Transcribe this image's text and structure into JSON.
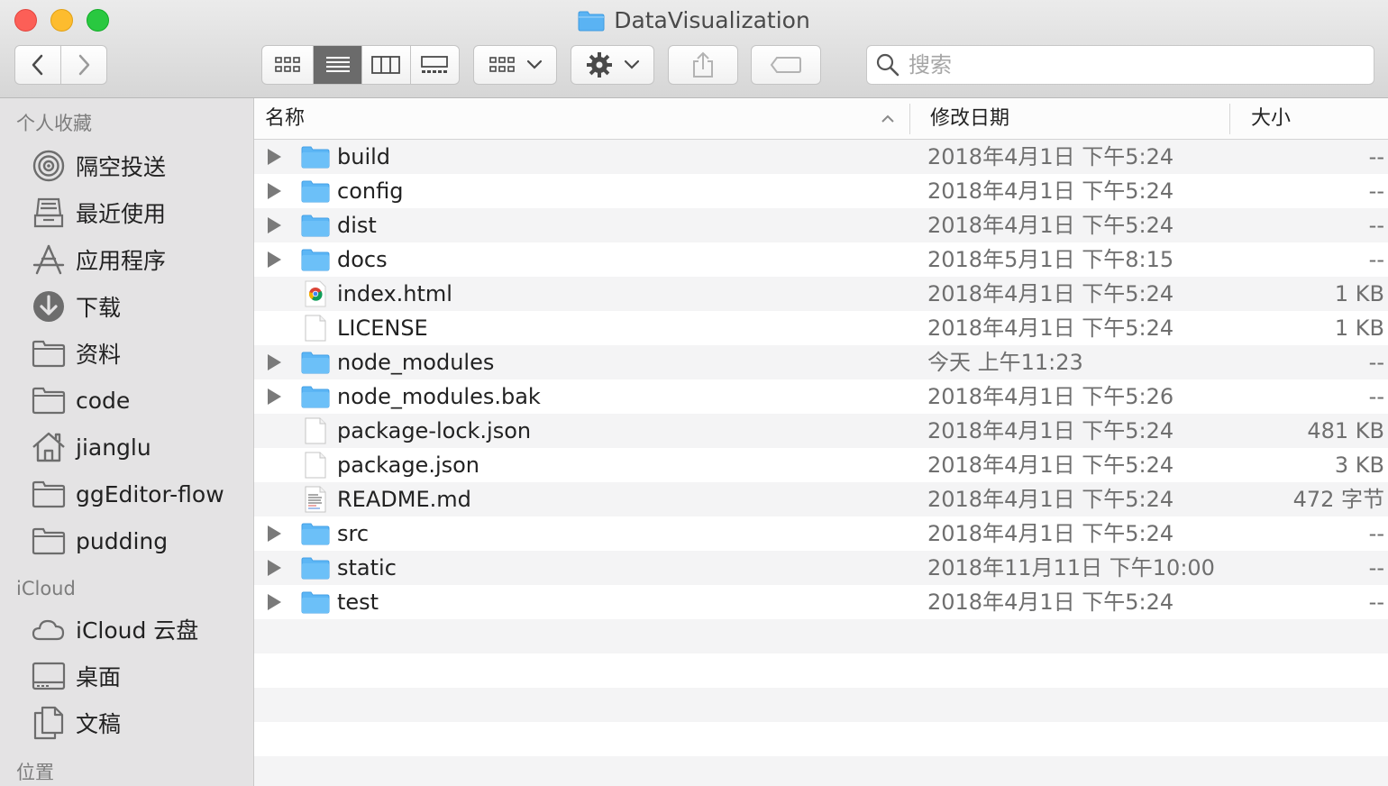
{
  "window": {
    "title": "DataVisualization"
  },
  "toolbar": {
    "search_placeholder": "搜索",
    "view_modes": [
      "icon-view",
      "list-view",
      "column-view",
      "gallery-view"
    ],
    "active_view": "list-view"
  },
  "sidebar": {
    "favorites_header": "个人收藏",
    "favorites": [
      {
        "label": "隔空投送",
        "icon": "airdrop-icon"
      },
      {
        "label": "最近使用",
        "icon": "recents-icon"
      },
      {
        "label": "应用程序",
        "icon": "applications-icon"
      },
      {
        "label": "下载",
        "icon": "downloads-icon"
      },
      {
        "label": "资料",
        "icon": "folder-icon"
      },
      {
        "label": "code",
        "icon": "folder-icon"
      },
      {
        "label": "jianglu",
        "icon": "home-icon"
      },
      {
        "label": "ggEditor-flow",
        "icon": "folder-icon"
      },
      {
        "label": "pudding",
        "icon": "folder-icon"
      }
    ],
    "icloud_header": "iCloud",
    "icloud": [
      {
        "label": "iCloud 云盘",
        "icon": "icloud-icon"
      },
      {
        "label": "桌面",
        "icon": "desktop-icon"
      },
      {
        "label": "文稿",
        "icon": "documents-icon"
      }
    ],
    "locations_header": "位置"
  },
  "columns": {
    "name": "名称",
    "date": "修改日期",
    "size": "大小"
  },
  "files": [
    {
      "name": "build",
      "date": "2018年4月1日 下午5:24",
      "size": "--",
      "kind": "folder"
    },
    {
      "name": "config",
      "date": "2018年4月1日 下午5:24",
      "size": "--",
      "kind": "folder"
    },
    {
      "name": "dist",
      "date": "2018年4月1日 下午5:24",
      "size": "--",
      "kind": "folder"
    },
    {
      "name": "docs",
      "date": "2018年5月1日 下午8:15",
      "size": "--",
      "kind": "folder"
    },
    {
      "name": "index.html",
      "date": "2018年4月1日 下午5:24",
      "size": "1 KB",
      "kind": "html"
    },
    {
      "name": "LICENSE",
      "date": "2018年4月1日 下午5:24",
      "size": "1 KB",
      "kind": "file"
    },
    {
      "name": "node_modules",
      "date": "今天 上午11:23",
      "size": "--",
      "kind": "folder"
    },
    {
      "name": "node_modules.bak",
      "date": "2018年4月1日 下午5:26",
      "size": "--",
      "kind": "folder"
    },
    {
      "name": "package-lock.json",
      "date": "2018年4月1日 下午5:24",
      "size": "481 KB",
      "kind": "file"
    },
    {
      "name": "package.json",
      "date": "2018年4月1日 下午5:24",
      "size": "3 KB",
      "kind": "file"
    },
    {
      "name": "README.md",
      "date": "2018年4月1日 下午5:24",
      "size": "472 字节",
      "kind": "text"
    },
    {
      "name": "src",
      "date": "2018年4月1日 下午5:24",
      "size": "--",
      "kind": "folder"
    },
    {
      "name": "static",
      "date": "2018年11月11日 下午10:00",
      "size": "--",
      "kind": "folder"
    },
    {
      "name": "test",
      "date": "2018年4月1日 下午5:24",
      "size": "--",
      "kind": "folder"
    }
  ]
}
